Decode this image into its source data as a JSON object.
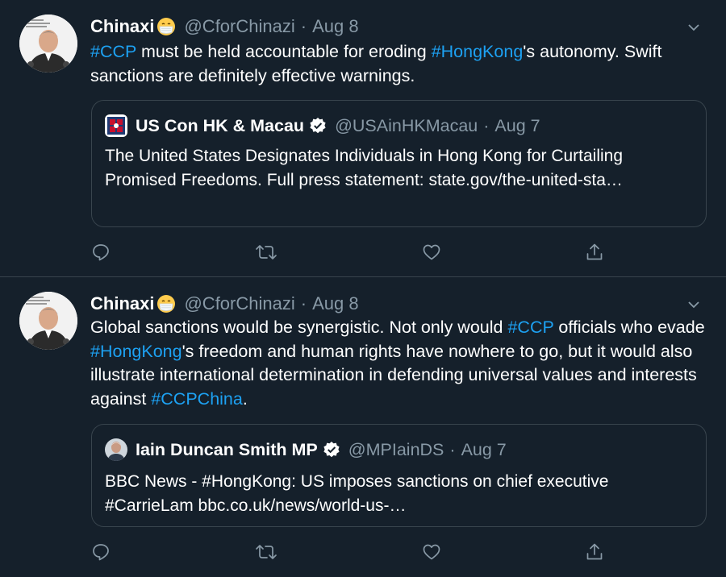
{
  "tweets": [
    {
      "author": "Chinaxi",
      "handle": "@CforChinazi",
      "dot": "·",
      "date": "Aug 8",
      "text_parts": [
        {
          "t": "#CCP",
          "tag": true
        },
        {
          "t": " must be held accountable for eroding ",
          "tag": false
        },
        {
          "t": "#HongKong",
          "tag": true
        },
        {
          "t": "'s autonomy. Swift sanctions are definitely effective warnings.",
          "tag": false
        }
      ],
      "quote": {
        "author": "US Con HK & Macau",
        "handle": "@USAinHKMacau",
        "dot": "·",
        "date": "Aug 7",
        "text": "The United States Designates Individuals in Hong Kong for Curtailing Promised Freedoms. Full press statement: state.gov/the-united-sta…"
      }
    },
    {
      "author": "Chinaxi",
      "handle": "@CforChinazi",
      "dot": "·",
      "date": "Aug 8",
      "text_parts": [
        {
          "t": "Global sanctions would be synergistic. Not only would ",
          "tag": false
        },
        {
          "t": "#CCP",
          "tag": true
        },
        {
          "t": " officials who evade ",
          "tag": false
        },
        {
          "t": "#HongKong",
          "tag": true
        },
        {
          "t": "'s freedom and human rights have nowhere to go, but it would also illustrate international determination in defending universal values and interests against ",
          "tag": false
        },
        {
          "t": "#CCPChina",
          "tag": true
        },
        {
          "t": ".",
          "tag": false
        }
      ],
      "quote": {
        "author": "Iain Duncan Smith MP",
        "handle": "@MPIainDS",
        "dot": "·",
        "date": "Aug 7",
        "text": "BBC News - #HongKong: US imposes sanctions on chief executive #CarrieLam bbc.co.uk/news/world-us-…"
      }
    }
  ],
  "icons": {
    "reply": "reply-icon",
    "retweet": "retweet-icon",
    "like": "like-icon",
    "share": "share-icon",
    "caret": "chevron-down-icon",
    "verified": "verified-badge-icon",
    "emoji": "face-with-mask-emoji"
  },
  "colors": {
    "background": "#15202b",
    "border": "#38444d",
    "muted": "#8899a6",
    "link": "#1da1f2",
    "verified": "#ffffff"
  }
}
